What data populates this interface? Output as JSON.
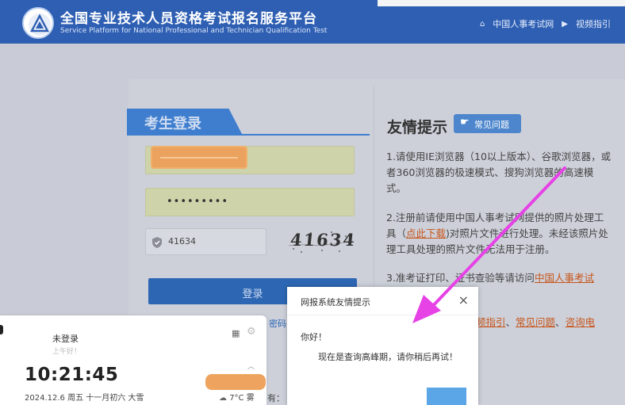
{
  "header": {
    "title_cn": "全国专业技术人员资格考试报名服务平台",
    "title_en": "Service Platform for National Professional and Technician Qualification Test",
    "nav": [
      {
        "icon": "home-icon",
        "label": "中国人事考试网"
      },
      {
        "icon": "play-circle-icon",
        "label": "视频指引"
      }
    ]
  },
  "login": {
    "tab_label": "考生登录",
    "password_value": "•••••••••",
    "captcha_value": "41634",
    "captcha_image_text": "41634",
    "submit_label": "登录",
    "forgot_link": "密码"
  },
  "tips": {
    "title": "友情提示",
    "faq_label": "常见问题",
    "item1": "1.请使用IE浏览器（10以上版本）、谷歌浏览器，或者360浏览器的极速模式、搜狗浏览器的高速模式。",
    "item2_pre": "2.注册前请使用中国人事考试网提供的照片处理工具（",
    "item2_link": "点此下载",
    "item2_post": ")对照片文件进行处理。未经该照片处理工具处理的照片文件无法用于注册。",
    "item3_pre": "3.准考证打印、证书查验等请访问",
    "item3_link": "中国人事考试",
    "item4_link1": "频指引",
    "item4_sep1": "、",
    "item4_link2": "常见问题",
    "item4_sep2": "、",
    "item4_link3": "咨询电"
  },
  "modal": {
    "title": "网报系统友情提示",
    "close": "×",
    "greeting": "你好！",
    "message": "现在是查询高峰期，请你稍后再试！"
  },
  "widget": {
    "status": "未登录",
    "greeting": "上午好！",
    "time": "10:21:45",
    "date": "2024.12.6 周五 十一月初六 大雪",
    "weather": "7°C 雾"
  },
  "bottom_text": "有：",
  "colors": {
    "header_bg": "#2e5fb3",
    "primary": "#2d67b4",
    "link_orange": "#c7561b",
    "arrow_magenta": "#e642e6",
    "redaction": "#eea45f"
  }
}
